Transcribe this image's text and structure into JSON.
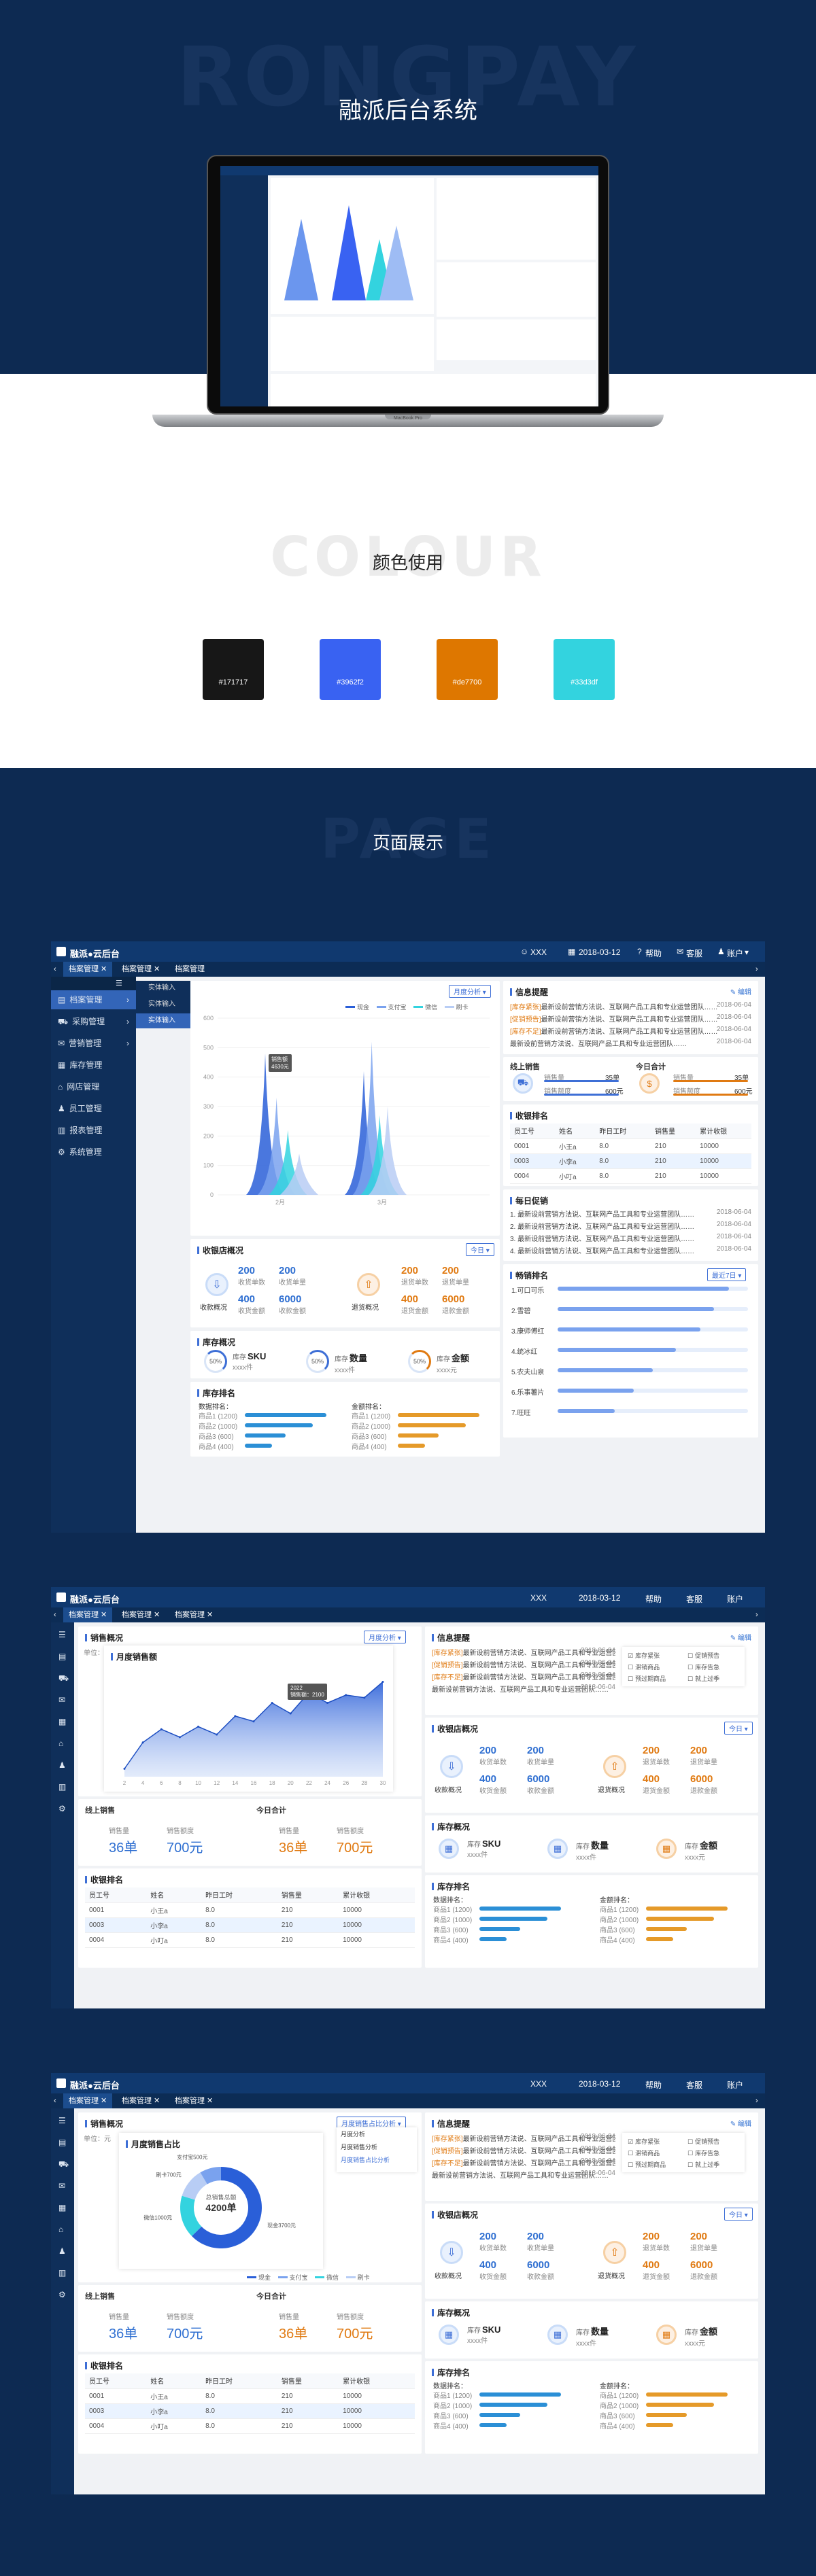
{
  "hero": {
    "watermark": "RONGPAY",
    "title": "融派后台系统"
  },
  "laptop": {
    "brand_label": "MacBook Pro"
  },
  "colour": {
    "watermark": "COLOUR",
    "title": "颜色使用",
    "swatches": [
      {
        "hex": "#171717",
        "label": "#171717"
      },
      {
        "hex": "#3962f2",
        "label": "#3962f2"
      },
      {
        "hex": "#de7700",
        "label": "#de7700"
      },
      {
        "hex": "#33d3df",
        "label": "#33d3df"
      }
    ]
  },
  "page": {
    "watermark": "PAGE",
    "title": "页面展示"
  },
  "app": {
    "logo": "融派●云后台",
    "user": "XXX",
    "date": "2018-03-12",
    "help": "帮助",
    "service": "客服",
    "account": "账户",
    "tabs": [
      "档案管理",
      "档案管理",
      "档案管理"
    ],
    "sidebar": [
      "档案管理",
      "采购管理",
      "营销管理",
      "库存管理",
      "网店管理",
      "员工管理",
      "报表管理",
      "系统管理"
    ],
    "submenu": [
      "实体输入",
      "实体输入",
      "实体输入"
    ],
    "sales_title": "销售概况",
    "sales_select": "月度分析",
    "sales_legend": [
      "现金",
      "支付宝",
      "微信",
      "刷卡"
    ],
    "sales_yticks": [
      "600",
      "500",
      "400",
      "300",
      "200",
      "100",
      "0"
    ],
    "sales_xticks": [
      "2月",
      "3月"
    ],
    "tooltip": [
      "销售额",
      "4630元"
    ],
    "info_title": "信息提醒",
    "info_edit": "编辑",
    "messages": [
      {
        "tag": "[库存紧张]",
        "text": "最新设前营销方法说、互联网产品工具和专业运营团队……",
        "date": "2018-06-04"
      },
      {
        "tag": "[促销预告]",
        "text": "最新设前营销方法说、互联网产品工具和专业运营团队……",
        "date": "2018-06-04"
      },
      {
        "tag": "[库存不足]",
        "text": "最新设前营销方法说、互联网产品工具和专业运营团队……",
        "date": "2018-06-04"
      },
      {
        "tag": "",
        "text": "最新设前营销方法说、互联网产品工具和专业运营团队……",
        "date": "2018-06-04"
      }
    ],
    "online_title": "线上销售",
    "online_labels": [
      "销售量",
      "销售额度"
    ],
    "online_values": [
      "35单",
      "600元"
    ],
    "today_title": "今日合计",
    "today_labels": [
      "销售量",
      "销售额度"
    ],
    "today_values": [
      "35单",
      "600元"
    ],
    "cashier_title": "收银排名",
    "cashier_cols": [
      "员工号",
      "姓名",
      "昨日工时",
      "销售量",
      "累计收银"
    ],
    "cashier_rows": [
      [
        "0001",
        "小王a",
        "8.0",
        "210",
        "10000"
      ],
      [
        "0003",
        "小李a",
        "8.0",
        "210",
        "10000"
      ],
      [
        "0004",
        "小叮a",
        "8.0",
        "210",
        "10000"
      ]
    ],
    "store_title": "收银店概况",
    "store_select": "今日",
    "store_a_label": "收款概况",
    "store_b_label": "退货概况",
    "store_nums": [
      [
        "200",
        "收货单数"
      ],
      [
        "200",
        "收货单量"
      ],
      [
        "400",
        "收货金额"
      ],
      [
        "6000",
        "收款金额"
      ]
    ],
    "store_nums_b": [
      [
        "200",
        "退货单数"
      ],
      [
        "200",
        "退货单量"
      ],
      [
        "400",
        "退货金额"
      ],
      [
        "6000",
        "退款金额"
      ]
    ],
    "notice_title": "每日促销",
    "notices": [
      {
        "text": "1. 最新设前营销方法说、互联网产品工具和专业运营团队……",
        "date": "2018-06-04"
      },
      {
        "text": "2. 最新设前营销方法说、互联网产品工具和专业运营团队……",
        "date": "2018-06-04"
      },
      {
        "text": "3. 最新设前营销方法说、互联网产品工具和专业运营团队……",
        "date": "2018-06-04"
      },
      {
        "text": "4. 最新设前营销方法说、互联网产品工具和专业运营团队……",
        "date": "2018-06-04"
      }
    ],
    "stock_title": "库存概况",
    "stock_items": [
      {
        "pct": "50%",
        "name": "SKU",
        "sub": "xxxx件"
      },
      {
        "pct": "50%",
        "name": "数量",
        "sub": "xxxx件"
      },
      {
        "pct": "50%",
        "name": "金额",
        "sub": "xxxx元"
      }
    ],
    "stock_prefix": "库存",
    "rank_title": "库存排名",
    "rank_col_a": "数据排名：",
    "rank_col_b": "金额排名：",
    "rank_items": [
      "商品1 (1200)",
      "商品2 (1000)",
      "商品3 (600)",
      "商品4 (400)"
    ],
    "top_title": "畅销排名",
    "top_select": "最近7日",
    "top_items": [
      "1.可口可乐",
      "2.雪碧",
      "3.康师傅红",
      "4.统冰红",
      "5.农夫山泉",
      "6.乐事薯片",
      "7.旺旺"
    ]
  },
  "app2": {
    "chart_title": "月度销售额",
    "unit": "单位：元",
    "tooltip": [
      "2022",
      "销售额：2100"
    ],
    "xticks": [
      "2",
      "4",
      "6",
      "8",
      "10",
      "12",
      "14",
      "16",
      "18",
      "20",
      "22",
      "24",
      "26",
      "28",
      "30"
    ],
    "online_a": "36单",
    "online_b": "700元",
    "today_a": "36单",
    "today_b": "700元",
    "filters": [
      "库存紧张",
      "促销预告",
      "滞销商品",
      "库存告急",
      "预过期商品",
      "就上过季"
    ]
  },
  "app3": {
    "pie_title": "月度销售占比",
    "pie_center_label": "总销售总额",
    "pie_center_value": "4200单",
    "pie_labels": [
      "现金3700元",
      "微信1000元",
      "刷卡700元",
      "支付宝500元"
    ],
    "select_options": [
      "月度分析",
      "月度销售分析",
      "月度销售占比分析"
    ],
    "legend": [
      "现金",
      "支付宝",
      "微信",
      "刷卡"
    ]
  },
  "chart_data": [
    {
      "type": "area",
      "title": "",
      "categories": [
        "2月",
        "3月"
      ],
      "ylim": [
        0,
        600
      ],
      "series": [
        {
          "name": "现金",
          "values": [
            480,
            420
          ]
        },
        {
          "name": "支付宝",
          "values": [
            330,
            520
          ]
        },
        {
          "name": "微信",
          "values": [
            220,
            270
          ]
        },
        {
          "name": "刷卡",
          "values": [
            140,
            300
          ]
        }
      ]
    },
    {
      "type": "area",
      "title": "月度销售额",
      "ylabel": "单位：元",
      "ylim": [
        0,
        4000
      ],
      "x": [
        2,
        4,
        6,
        8,
        10,
        12,
        14,
        16,
        18,
        20,
        22,
        24,
        26,
        28,
        30
      ],
      "series": [
        {
          "values": [
            300,
            1300,
            1800,
            1500,
            1900,
            1600,
            2300,
            2100,
            2800,
            2400,
            3200,
            2800,
            3100,
            3000,
            3600
          ]
        }
      ]
    },
    {
      "type": "pie",
      "title": "月度销售占比",
      "series": [
        {
          "name": "现金",
          "values": [
            3700
          ]
        },
        {
          "name": "微信",
          "values": [
            1000
          ]
        },
        {
          "name": "刷卡",
          "values": [
            700
          ]
        },
        {
          "name": "支付宝",
          "values": [
            500
          ]
        }
      ]
    }
  ],
  "colors": {
    "navy": "#0d2a52",
    "accent": "#3962f2",
    "orange": "#de7700",
    "cyan": "#33d3df"
  }
}
